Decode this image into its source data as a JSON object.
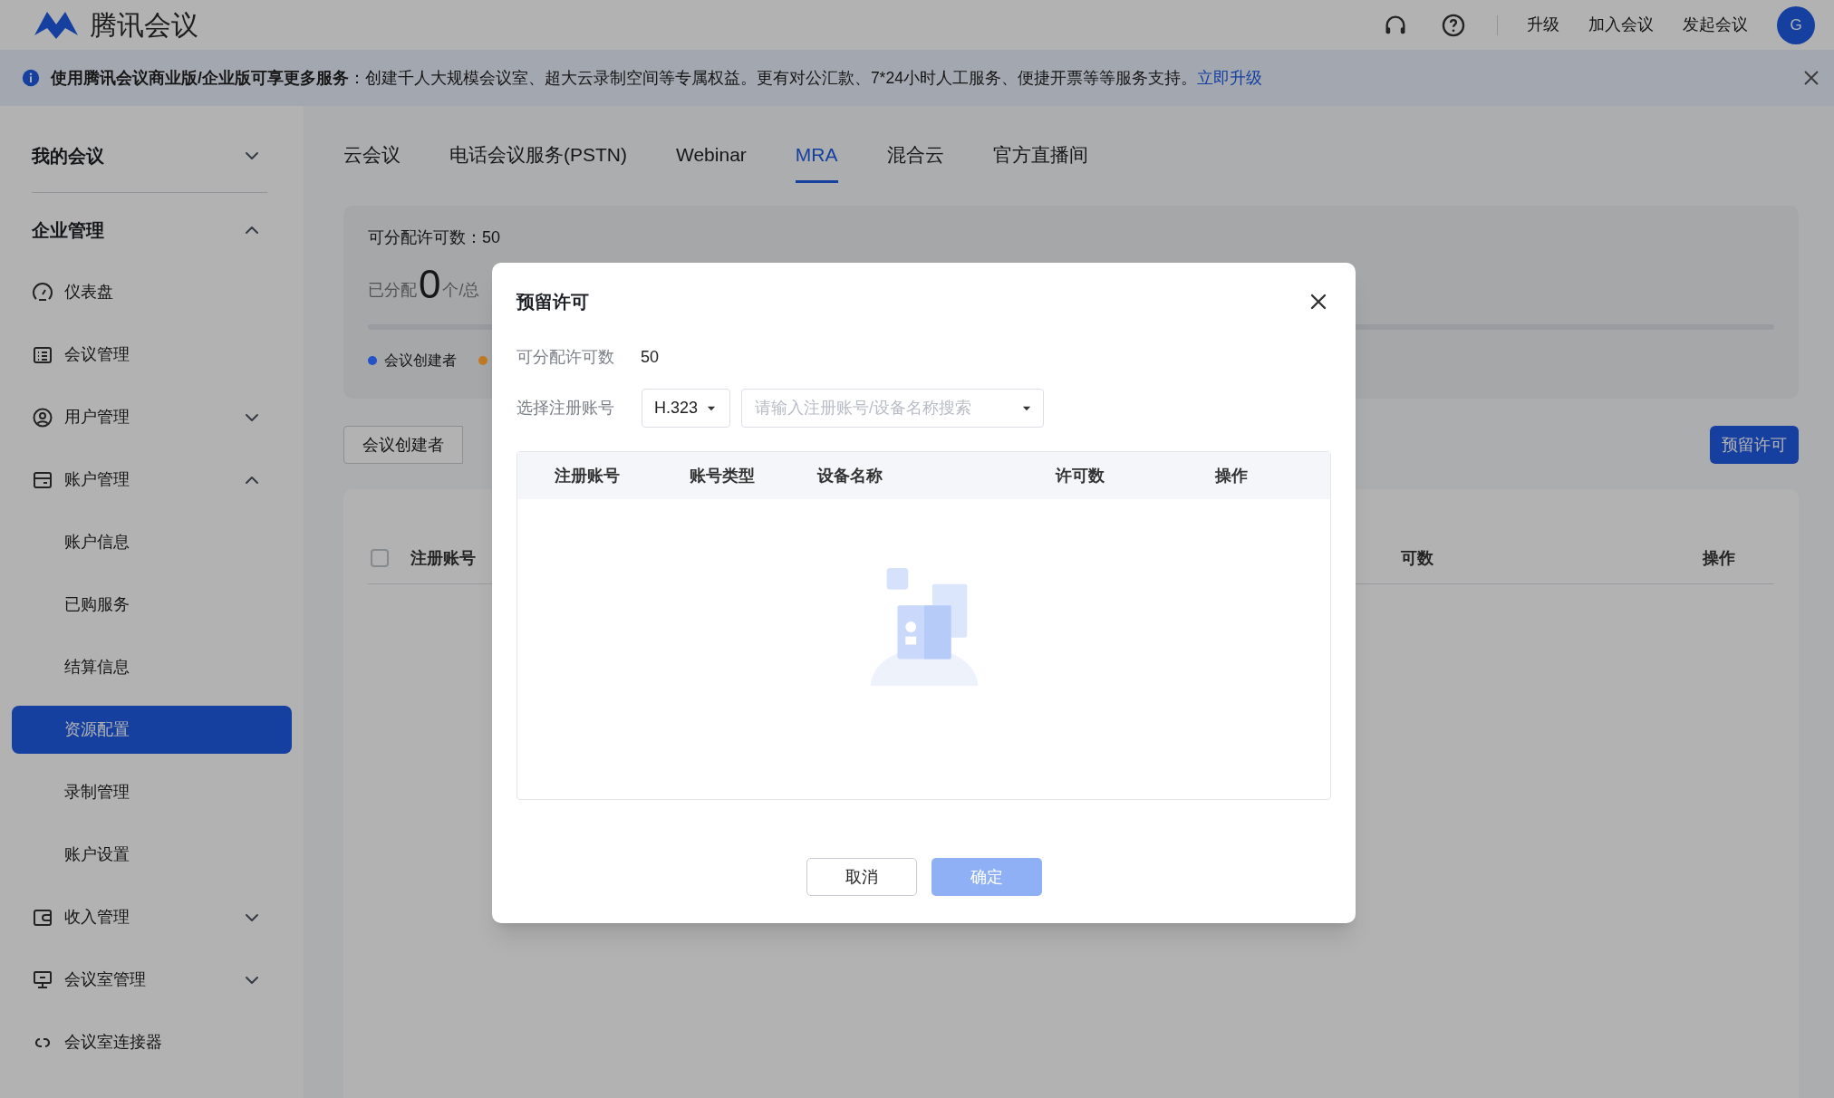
{
  "header": {
    "logo_text": "腾讯会议",
    "links": [
      "升级",
      "加入会议",
      "发起会议"
    ],
    "avatar": "G"
  },
  "banner": {
    "text": "**使用腾讯会议商业版/企业版可享更多服务**：创建千人大规模会议室、超大云录制空间等专属权益。更有对公汇款、7*24小时人工服务、便捷开票等等服务支持。",
    "link": "立即升级"
  },
  "sidebar": [
    {
      "label": "我的会议",
      "expanded": false
    },
    {
      "label": "企业管理",
      "expanded": true,
      "children": [
        {
          "label": "仪表盘",
          "selected": false
        },
        {
          "label": "会议管理",
          "selected": false
        },
        {
          "label": "用户管理",
          "selected": false,
          "expanded": false
        },
        {
          "label": "账户管理",
          "selected": false,
          "expanded": true,
          "children": [
            {
              "label": "账户信息",
              "selected": false
            },
            {
              "label": "已购服务",
              "selected": false
            },
            {
              "label": "结算信息",
              "selected": false
            },
            {
              "label": "资源配置",
              "selected": true
            },
            {
              "label": "录制管理",
              "selected": false
            },
            {
              "label": "账户设置",
              "selected": false
            }
          ]
        },
        {
          "label": "收入管理",
          "selected": false,
          "expanded": false
        },
        {
          "label": "会议室管理",
          "selected": false,
          "expanded": false
        },
        {
          "label": "会议室连接器",
          "selected": false
        }
      ]
    }
  ],
  "tabs": [
    {
      "label": "云会议",
      "selected": false
    },
    {
      "label": "电话会议服务(PSTN)",
      "selected": false
    },
    {
      "label": "Webinar",
      "selected": false
    },
    {
      "label": "MRA",
      "selected": true
    },
    {
      "label": "混合云",
      "selected": false
    },
    {
      "label": "官方直播间",
      "selected": false
    }
  ],
  "summary": {
    "available_label": "可分配许可数：",
    "available_value": "50",
    "allocated_label": "已分配",
    "allocated_value": "0",
    "allocated_unit": "个/总",
    "level": 0,
    "legend": [
      {
        "label": "会议创建者",
        "color": "#2552c4"
      },
      {
        "color": "#c07a26"
      }
    ]
  },
  "segments": [
    {
      "label": "会议创建者",
      "selected": true
    }
  ],
  "reserve_button": "预留许可",
  "table": {
    "select_all": {
      "checked": false
    },
    "columns": [
      "注册账号",
      "可数",
      "操作"
    ]
  },
  "dialog": {
    "title": "预留许可",
    "available_label": "可分配许可数",
    "available_value": "50",
    "account_label": "选择注册账号",
    "type_select": "H.323",
    "search": {
      "placeholder": "请输入注册账号/设备名称搜索"
    },
    "columns": [
      "注册账号",
      "账号类型",
      "设备名称",
      "许可数",
      "操作"
    ],
    "buttons": [
      {
        "label": "取消",
        "disabled": false,
        "primary": false
      },
      {
        "label": "确定",
        "disabled": true,
        "primary": true
      }
    ]
  }
}
